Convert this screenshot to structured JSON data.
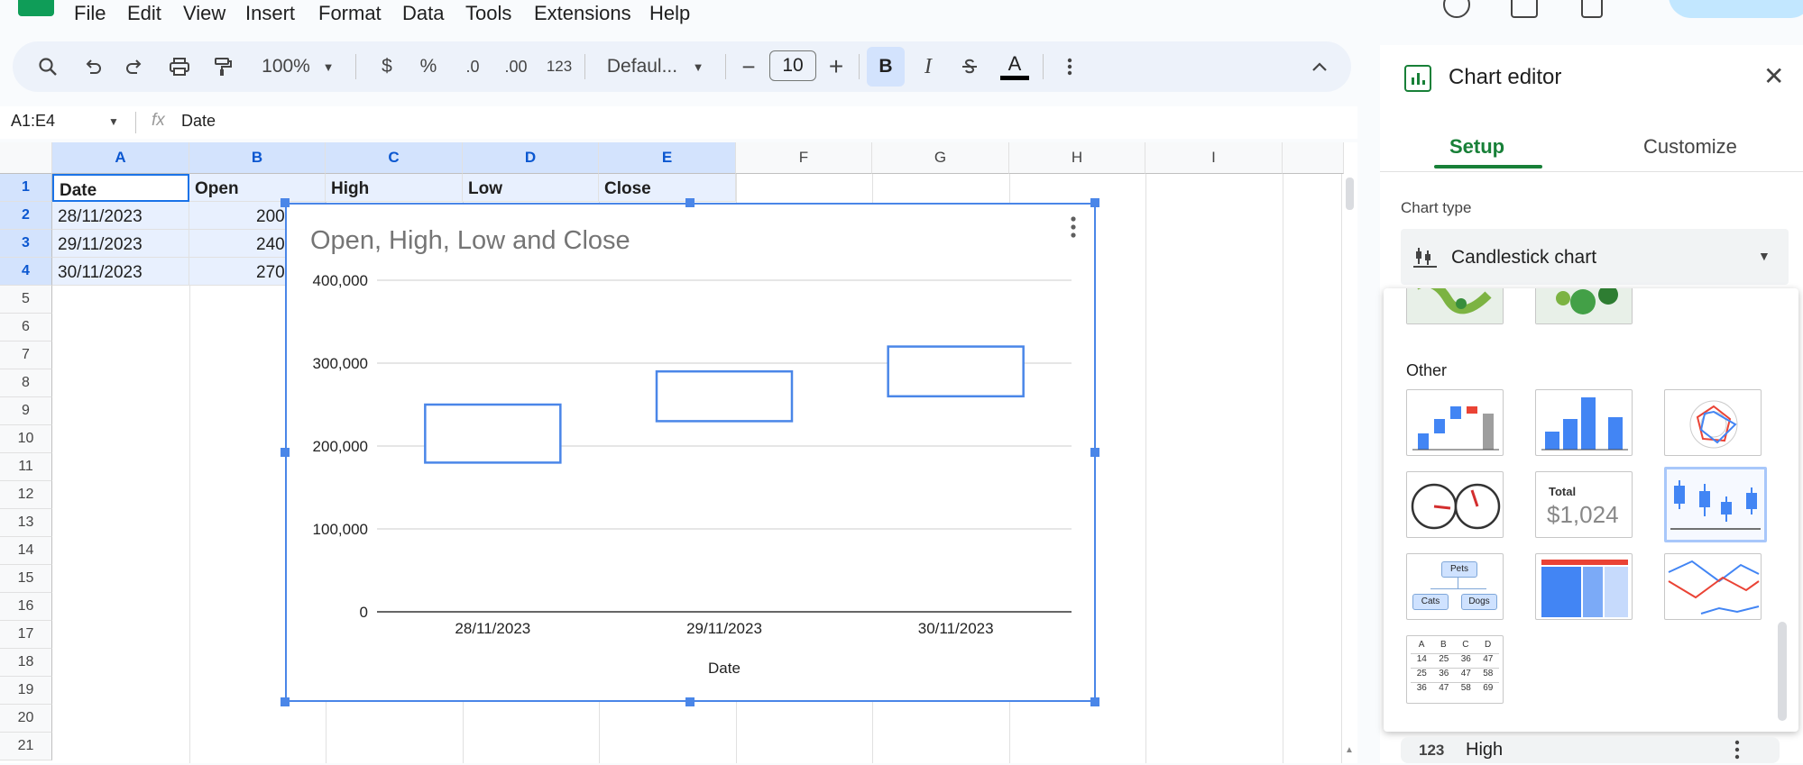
{
  "menu": [
    "File",
    "Edit",
    "View",
    "Insert",
    "Format",
    "Data",
    "Tools",
    "Extensions",
    "Help"
  ],
  "toolbar": {
    "zoom": "100%",
    "currency": "$",
    "percent": "%",
    "dec_decrease": ".0",
    "dec_increase": ".00",
    "number_format": "123",
    "font": "Defaul...",
    "minus": "−",
    "font_size": "10",
    "plus": "+",
    "bold": "B",
    "italic": "I",
    "text_color": "A"
  },
  "formula_bar": {
    "range": "A1:E4",
    "fx": "fx",
    "value": "Date"
  },
  "columns": [
    "A",
    "B",
    "C",
    "D",
    "E",
    "F",
    "G",
    "H",
    "I"
  ],
  "rows": [
    "1",
    "2",
    "3",
    "4",
    "5",
    "6",
    "7",
    "8",
    "9",
    "10",
    "11",
    "12",
    "13",
    "14",
    "15",
    "16",
    "17",
    "18",
    "19",
    "20",
    "21"
  ],
  "sheet": {
    "header": [
      "Date",
      "Open",
      "High",
      "Low",
      "Close"
    ],
    "data": [
      [
        "28/11/2023",
        "200"
      ],
      [
        "29/11/2023",
        "240"
      ],
      [
        "30/11/2023",
        "270"
      ]
    ]
  },
  "chart_data": {
    "type": "candlestick",
    "title": "Open, High, Low and Close",
    "xlabel": "Date",
    "ylabel": "",
    "categories": [
      "28/11/2023",
      "29/11/2023",
      "30/11/2023"
    ],
    "boxes": [
      {
        "low": 180000,
        "high": 250000
      },
      {
        "low": 230000,
        "high": 290000
      },
      {
        "low": 260000,
        "high": 320000
      }
    ],
    "yticks": [
      0,
      100000,
      200000,
      300000,
      400000
    ],
    "ytick_labels": [
      "0",
      "100,000",
      "200,000",
      "300,000",
      "400,000"
    ],
    "ylim": [
      0,
      400000
    ],
    "grid": true,
    "colors": {
      "series": "#4a86e8"
    }
  },
  "panel": {
    "title": "Chart editor",
    "tabs": [
      "Setup",
      "Customize"
    ],
    "chart_type_label": "Chart type",
    "chart_type_value": "Candlestick chart",
    "other_label": "Other",
    "scorecard_label": "Total",
    "scorecard_value": "$1,024",
    "org_labels": [
      "Pets",
      "Cats",
      "Dogs"
    ],
    "table_rows": [
      [
        "A",
        "B",
        "C",
        "D"
      ],
      [
        "14",
        "25",
        "36",
        "47"
      ],
      [
        "25",
        "36",
        "47",
        "58"
      ],
      [
        "36",
        "47",
        "58",
        "69"
      ]
    ],
    "next_series_icon": "123",
    "next_series": "High"
  }
}
